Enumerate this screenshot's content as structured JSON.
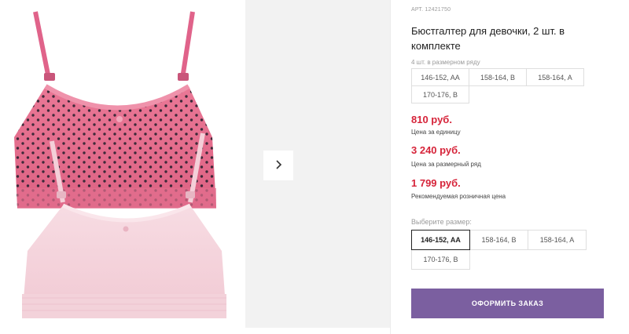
{
  "product": {
    "article": "АРТ. 12421750",
    "title": "Бюстгалтер для девочки, 2 шт. в комплекте",
    "pack_label": "4 шт. в размерном ряду"
  },
  "size_row_sizes": [
    "146-152, AA",
    "158-164, B",
    "158-164, A",
    "170-176, B"
  ],
  "prices": {
    "unit_price": "810 руб.",
    "unit_label": "Цена за единицу",
    "row_price": "3 240 руб.",
    "row_label": "Цена за размерный ряд",
    "retail_price": "1 799 руб.",
    "retail_label": "Рекомендуемая розничная цена"
  },
  "size_picker": {
    "label": "Выберите размер:",
    "options": [
      "146-152, AA",
      "158-164, B",
      "158-164, A",
      "170-176, B"
    ],
    "selected": "146-152, AA"
  },
  "order_button": "ОФОРМИТЬ ЗАКАЗ",
  "colors": {
    "accent_price": "#d6243a",
    "order_button": "#7b5fa0",
    "bra_pink": "#e8708f",
    "bra_light": "#f5d3dc"
  },
  "icons": {
    "next": "chevron-right-icon"
  }
}
